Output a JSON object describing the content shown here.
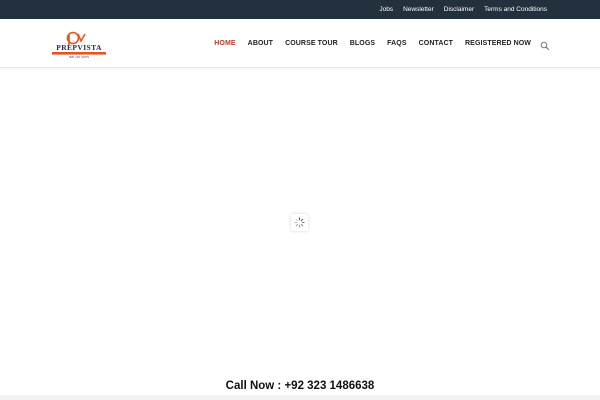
{
  "topbar": {
    "links": [
      {
        "label": "Jobs"
      },
      {
        "label": "Newsletter"
      },
      {
        "label": "Disclaimer"
      },
      {
        "label": "Terms and Conditions"
      }
    ]
  },
  "header": {
    "logo_text": "PREPVISTA",
    "logo_subtext": "SMC | SCI | NOTS",
    "nav": [
      {
        "label": "HOME",
        "active": true
      },
      {
        "label": "ABOUT"
      },
      {
        "label": "COURSE TOUR"
      },
      {
        "label": "BLOGS"
      },
      {
        "label": "FAQS"
      },
      {
        "label": "CONTACT"
      },
      {
        "label": "REGISTERED NOW"
      }
    ]
  },
  "call_now": "Call Now : +92 323 1486638",
  "colors": {
    "topbar_bg": "#23303d",
    "accent": "#c0392b",
    "logo_orange": "#e8541e",
    "logo_navy": "#1f2a55"
  },
  "icons": {
    "search": "search-icon",
    "loader": "spinner-icon"
  }
}
